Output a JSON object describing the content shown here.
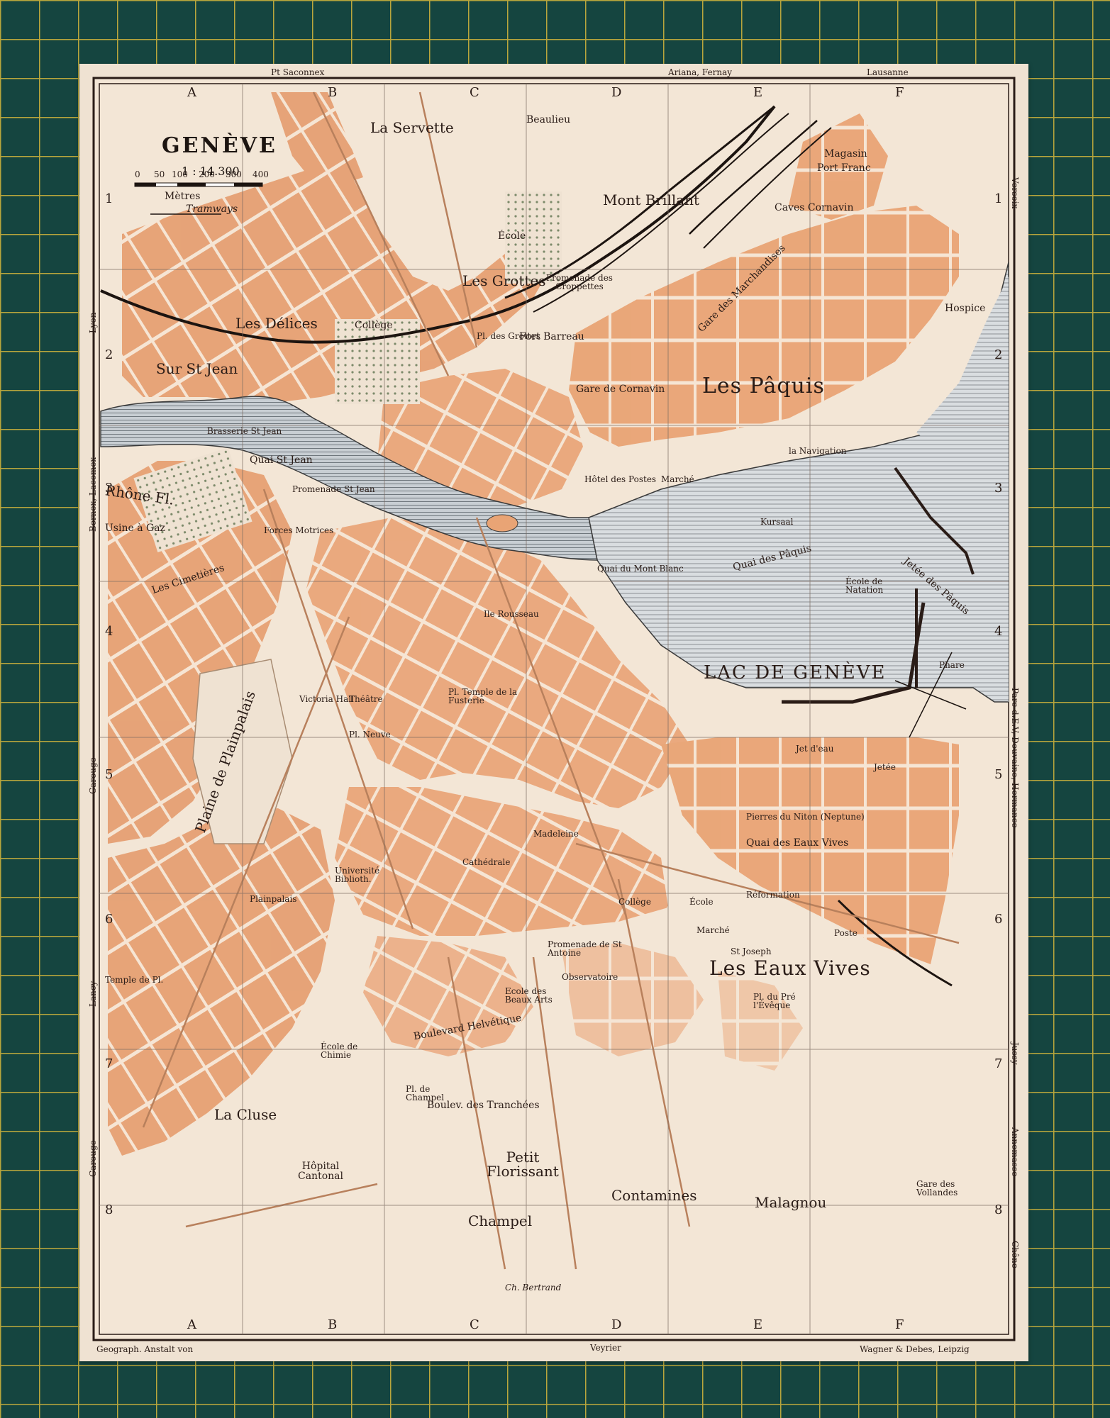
{
  "map": {
    "title": "GENÈVE",
    "scale": "1 : 14.300",
    "scale_bar": {
      "ticks": [
        "0",
        "50",
        "100",
        "200",
        "300",
        "400"
      ],
      "unit_label": "Mètres"
    },
    "legend_tramways": "Tramways",
    "grid_columns": [
      "A",
      "B",
      "C",
      "D",
      "E",
      "F"
    ],
    "grid_rows": [
      "1",
      "2",
      "3",
      "4",
      "5",
      "6",
      "7",
      "8"
    ],
    "border_labels": {
      "top_left": "Pt Saconnex",
      "top_mid": "Ariana, Fernay",
      "top_right": "Lausanne",
      "bottom_mid": "Veyrier",
      "left_lyon": "Lyon",
      "left_bernex": "Bernex, Lacomex",
      "left_carouge": "Carouge",
      "left_lancy": "Lancy",
      "left_carouge2": "Carouge",
      "right_versoix": "Versoix",
      "right_parc": "Parc d.E.V, Douvaine, Hermance",
      "right_jussy": "Jussy",
      "right_annemasse": "Annemasse",
      "right_chene": "Chêne"
    },
    "imprint_left": "Geograph. Anstalt von",
    "imprint_right": "Wagner & Debes, Leipzig",
    "places": {
      "la_servette": "La Servette",
      "beaulieu": "Beaulieu",
      "mont_brillant": "Mont Brillant",
      "magasin": "Magasin",
      "port_franc": "Port Franc",
      "caves_cornavin": "Caves Cornavin",
      "les_delices": "Les Délices",
      "college1": "Collège",
      "les_grottes": "Les Grottes",
      "ecole1": "École",
      "promenade_croppettes": "Promenade des Croppettes",
      "gare_marchandises": "Gare des Marchandises",
      "hospice": "Hospice",
      "sur_st_jean": "Sur St Jean",
      "fort_barreau": "Fort Barreau",
      "pl_des_grottes": "Pl. des Grottes",
      "gare_cornavin": "Gare de Cornavin",
      "les_paquis": "Les Pâquis",
      "brasserie": "Brasserie St Jean",
      "quai_st_jean": "Quai St Jean",
      "rhone": "Rhône Fl.",
      "promenade_st_jean": "Promenade St Jean",
      "hotel_postes": "Hôtel des Postes",
      "marche": "Marché",
      "la_navigation": "la Navigation",
      "kursaal": "Kursaal",
      "usine_gaz": "Usine à Gaz",
      "forces_motrices": "Forces Motrices",
      "les_cimetieres": "Les Cimetières",
      "ile_rousseau": "Ile Rousseau",
      "quai_paquis": "Quai des Pâquis",
      "quai_mont_blanc": "Quai du Mont Blanc",
      "jetee_paquis": "Jetée des Pâquis",
      "ecole_natation": "École de Natation",
      "lac": "LAC DE GENÈVE",
      "phare": "Phare",
      "temple_fusterie": "Pl. Temple de la Fusterie",
      "victoria_hall": "Victoria Hall",
      "theatre": "Théâtre",
      "pl_neuve": "Pl. Neuve",
      "jet_eau": "Jet d'eau",
      "jetee": "Jetée",
      "pierres_niton": "Pierres du Niton (Neptune)",
      "plainpalais": "Plainpalais",
      "plaine_plainpalais": "Plaine de Plainpalais",
      "universite": "Université Biblioth.",
      "cathedrale": "Cathédrale",
      "madeleine": "Madeleine",
      "quai_eaux_vives": "Quai des Eaux Vives",
      "reformation": "Réformation",
      "ecole2": "École",
      "college2": "Collège",
      "promenade_st_antoine": "Promenade de St Antoine",
      "les_eaux_vives": "Les Eaux Vives",
      "observatoire": "Observatoire",
      "boulevard_helvetique": "Boulevard Helvétique",
      "ecole_beaux_arts": "Ecole des Beaux Arts",
      "ecole_chimie": "École de Chimie",
      "temple_plainpalais": "Temple de Pl.",
      "la_cluse": "La Cluse",
      "boulev_tranchees": "Boulev. des Tranchées",
      "pl_champel": "Pl. de Champel",
      "hopital_cantonal": "Hôpital Cantonal",
      "petit_florissant": "Petit Florissant",
      "contamines": "Contamines",
      "champel": "Champel",
      "malagnou": "Malagnou",
      "gare_vollandes": "Gare des Vollandes",
      "ch_bertrand": "Ch. Bertrand",
      "poste": "Poste",
      "prieure_eveque": "Pl. du Pré l'Évêque",
      "marche2": "Marché",
      "st_joseph": "St Joseph"
    }
  }
}
